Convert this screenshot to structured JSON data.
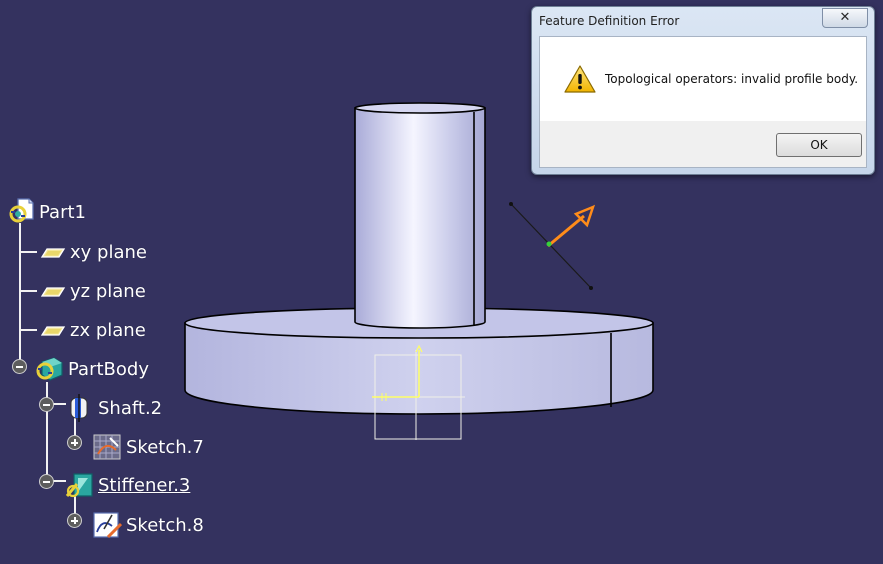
{
  "tree": {
    "part": "Part1",
    "planes": [
      "xy plane",
      "yz plane",
      "zx plane"
    ],
    "body": "PartBody",
    "shaft": "Shaft.2",
    "sketch_shaft": "Sketch.7",
    "stiffener": "Stiffener.3",
    "sketch_stiffener": "Sketch.8"
  },
  "dialog": {
    "title": "Feature Definition Error",
    "close_glyph": "✕",
    "message": "Topological operators: invalid profile body.",
    "ok_label": "OK"
  },
  "icons": {
    "part": "part-icon",
    "plane": "plane-icon",
    "body": "body-icon",
    "shaft": "shaft-icon",
    "sketch": "sketch-icon",
    "stiffener": "stiffener-icon",
    "warning": "warning-icon"
  },
  "colors": {
    "background": "#34325f",
    "model_fill": "#c5c7ea",
    "stiffener_profile": "#ffff66",
    "direction_arrow": "#ff8c1a"
  }
}
